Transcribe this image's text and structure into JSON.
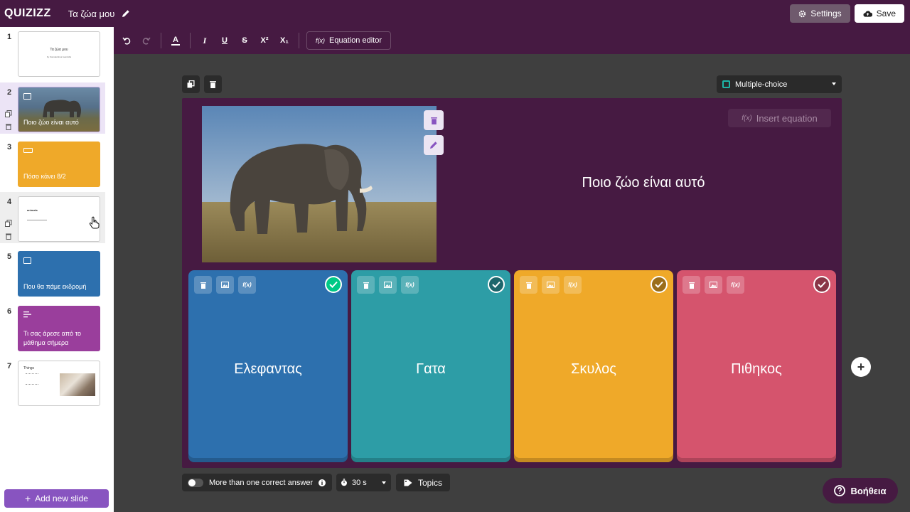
{
  "header": {
    "logo": "QUIZIZZ",
    "doc_title": "Τα ζώα μου",
    "settings_label": "Settings",
    "save_label": "Save"
  },
  "sidebar": {
    "slides": [
      {
        "num": "1",
        "thumb_title": "Τα ζώα μου",
        "thumb_sub": "by Konstantinos Ioannidis"
      },
      {
        "num": "2",
        "label": "Ποιο ζώο είναι αυτό"
      },
      {
        "num": "3",
        "label": "Πόσο κάνει 8/2"
      },
      {
        "num": "4",
        "thumb_title": "animals"
      },
      {
        "num": "5",
        "label": "Που θα πάμε εκδρομή"
      },
      {
        "num": "6",
        "label": "Τι σας άρεσε από το μάθημα σήμερα"
      },
      {
        "num": "7",
        "thumb_title": "Things"
      }
    ],
    "add_slide_label": "Add new slide"
  },
  "toolbar": {
    "equation_editor_label": "Equation editor",
    "bold_glyph": "A",
    "italic_glyph": "I",
    "underline_glyph": "U",
    "strike_glyph": "S",
    "sup_glyph": "X²",
    "sub_glyph": "X₁",
    "fx_glyph": "f(x)"
  },
  "question": {
    "type_label": "Multiple-choice",
    "text": "Ποιο ζώο είναι αυτό",
    "insert_equation_label": "Insert equation"
  },
  "answers": [
    {
      "text": "Ελεφαντας",
      "color": "#2d70ae",
      "correct": true
    },
    {
      "text": "Γατα",
      "color": "#2d9da6",
      "correct": false
    },
    {
      "text": "Σκυλος",
      "color": "#efa929",
      "correct": false
    },
    {
      "text": "Πιθηκος",
      "color": "#d5546d",
      "correct": false
    }
  ],
  "bottom": {
    "multi_correct_label": "More than one correct answer",
    "timer_label": "30 s",
    "topics_label": "Topics",
    "help_label": "Βοήθεια"
  },
  "colors": {
    "header_bg": "#461a42",
    "accent": "#8854c0",
    "canvas_bg": "#3f3f3f"
  }
}
